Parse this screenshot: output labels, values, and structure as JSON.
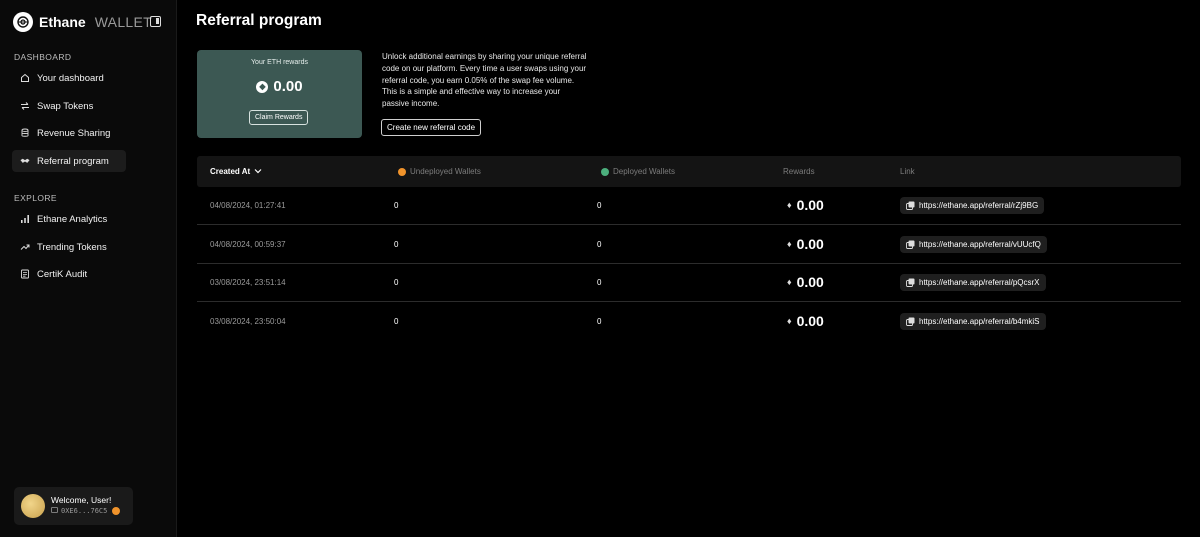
{
  "brand": {
    "name": "Ethane",
    "sub": "WALLET"
  },
  "sidebar": {
    "dashboard_label": "DASHBOARD",
    "dashboard_items": [
      {
        "label": "Your dashboard",
        "icon": "home-icon"
      },
      {
        "label": "Swap Tokens",
        "icon": "swap-icon"
      },
      {
        "label": "Revenue Sharing",
        "icon": "database-icon"
      },
      {
        "label": "Referral program",
        "icon": "handshake-icon",
        "active": true
      }
    ],
    "explore_label": "EXPLORE",
    "explore_items": [
      {
        "label": "Ethane Analytics",
        "icon": "bar-chart-icon"
      },
      {
        "label": "Trending Tokens",
        "icon": "trending-up-icon"
      },
      {
        "label": "CertiK Audit",
        "icon": "audit-icon"
      }
    ]
  },
  "user": {
    "welcome": "Welcome, User!",
    "address": "0XE6...76C5"
  },
  "page": {
    "title": "Referral program"
  },
  "rewards": {
    "label": "Your ETH rewards",
    "amount": "0.00",
    "claim_label": "Claim Rewards"
  },
  "description": "Unlock additional earnings by sharing your unique referral code on our platform. Every time a user swaps using your referral code, you earn 0.05% of the swap fee volume. This is a simple and effective way to increase your passive income.",
  "create_label": "Create new referral code",
  "table": {
    "headers": {
      "created_at": "Created At",
      "undeployed": "Undeployed Wallets",
      "deployed": "Deployed Wallets",
      "rewards": "Rewards",
      "link": "Link"
    },
    "rows": [
      {
        "date": "04/08/2024, 01:27:41",
        "undeployed": "0",
        "deployed": "0",
        "reward": "0.00",
        "link": "https://ethane.app/referral/rZj9BG"
      },
      {
        "date": "04/08/2024, 00:59:37",
        "undeployed": "0",
        "deployed": "0",
        "reward": "0.00",
        "link": "https://ethane.app/referral/vUUcfQ"
      },
      {
        "date": "03/08/2024, 23:51:14",
        "undeployed": "0",
        "deployed": "0",
        "reward": "0.00",
        "link": "https://ethane.app/referral/pQcsrX"
      },
      {
        "date": "03/08/2024, 23:50:04",
        "undeployed": "0",
        "deployed": "0",
        "reward": "0.00",
        "link": "https://ethane.app/referral/b4mkiS"
      }
    ]
  },
  "colors": {
    "background": "#000000",
    "card": "#3c5853",
    "undeployed_dot": "#f0932b",
    "deployed_dot": "#4caf7d"
  }
}
